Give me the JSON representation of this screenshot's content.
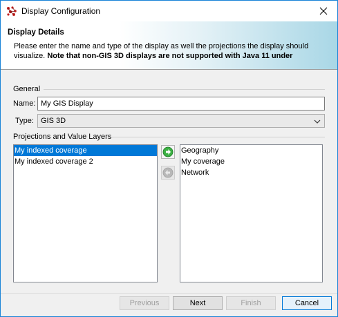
{
  "window": {
    "title": "Display Configuration"
  },
  "header": {
    "title": "Display Details",
    "description_plain": "Please enter the name and type of the display as well the projections the display should visualize.",
    "description_bold": "Note that non-GIS 3D displays are not supported with Java 11 under"
  },
  "general": {
    "section_label": "General",
    "name_label": "Name:",
    "name_value": "My GIS Display",
    "type_label": "Type:",
    "type_value": "GIS 3D"
  },
  "projections": {
    "section_label": "Projections and Value Layers",
    "left_items": [
      "My indexed coverage",
      "My indexed coverage 2"
    ],
    "selected_index": 0,
    "right_items": [
      "Geography",
      "My coverage",
      "Network"
    ]
  },
  "buttons": {
    "previous": "Previous",
    "next": "Next",
    "finish": "Finish",
    "cancel": "Cancel"
  },
  "colors": {
    "selection": "#0078d7",
    "add_arrow": "#3cb043",
    "window_border": "#1883d7"
  },
  "icons": {
    "app": "repast-app-icon",
    "close": "close-icon",
    "add": "arrow-right-icon",
    "remove": "arrow-left-icon",
    "dropdown": "chevron-down-icon"
  }
}
